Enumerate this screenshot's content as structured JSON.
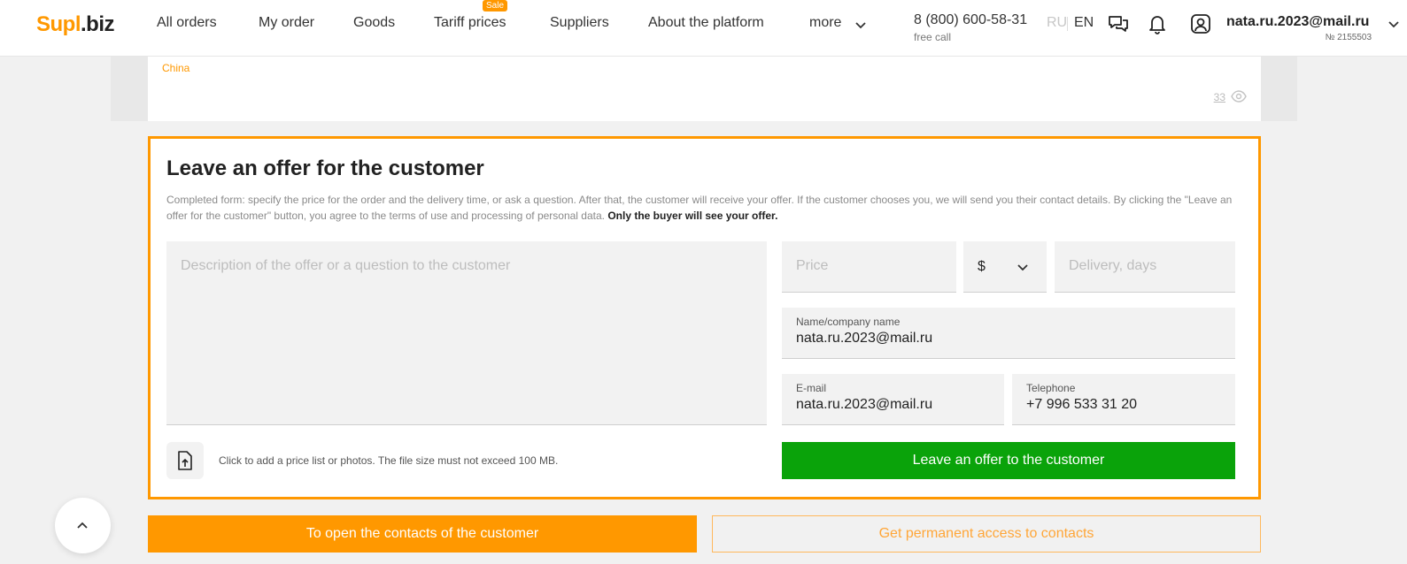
{
  "header": {
    "logo_part1": "Supl",
    "logo_part2": ".biz",
    "nav": {
      "all_orders": "All orders",
      "my_order": "My order",
      "goods": "Goods",
      "tariff_prices": "Tariff prices",
      "suppliers": "Suppliers",
      "about": "About the platform",
      "more": "more"
    },
    "sale_badge": "Sale",
    "phone": "8 (800) 600-58-31",
    "free_call": "free call",
    "lang_ru": "RU",
    "lang_en": "EN",
    "user_email": "nata.ru.2023@mail.ru",
    "user_id": "№ 2155503",
    "icons": [
      "chat-icon",
      "bell-icon",
      "user-icon",
      "chevron-down-icon"
    ]
  },
  "order_card": {
    "country": "China",
    "views": "33"
  },
  "offer": {
    "title": "Leave an offer for the customer",
    "description": "Completed form: specify the price for the order and the delivery time, or ask a question. After that, the customer will receive your offer. If the customer chooses you, we will send you their contact details. By clicking the \"Leave an offer for the customer\" button, you agree to the terms of use and processing of personal data.",
    "description_bold": "Only the buyer will see your offer.",
    "message_placeholder": "Description of the offer or a question to the customer",
    "price_placeholder": "Price",
    "currency": "$",
    "delivery_placeholder": "Delivery, days",
    "name_label": "Name/company name",
    "name_value": "nata.ru.2023@mail.ru",
    "email_label": "E-mail",
    "email_value": "nata.ru.2023@mail.ru",
    "phone_label": "Telephone",
    "phone_value": "+7 996 533 31 20",
    "attach_text": "Click to add a price list or photos. The file size must not exceed 100 MB.",
    "submit_label": "Leave an offer to the customer"
  },
  "actions": {
    "open_contacts": "To open the contacts of the customer",
    "permanent_access": "Get permanent access to contacts"
  },
  "colors": {
    "accent": "#ff9800",
    "submit": "#0aa30a",
    "background": "#f1f1f1"
  }
}
